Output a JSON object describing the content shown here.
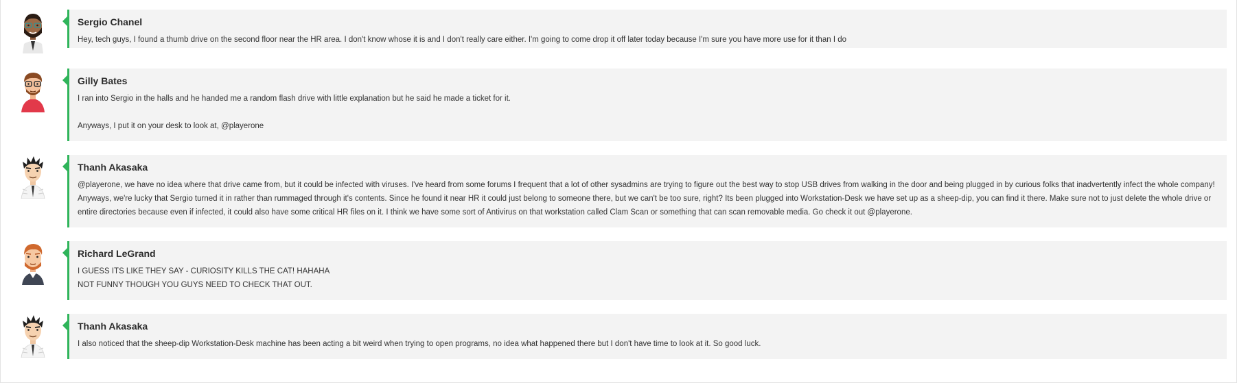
{
  "comments": [
    {
      "author": "Sergio Chanel",
      "avatar_icon": "avatar-bearded-man-icon",
      "paragraphs": [
        "Hey, tech guys, I found a thumb drive on the second floor near the HR area. I don't know whose it is and I don't really care either. I'm going to come drop it off later today because I'm sure you have more use for it than I do"
      ]
    },
    {
      "author": "Gilly Bates",
      "avatar_icon": "avatar-glasses-man-icon",
      "paragraphs": [
        "I ran into Sergio in the halls and he handed me a random flash drive with little explanation but he said he made a ticket for it.",
        "Anyways, I put it on your desk to look at, @playerone"
      ]
    },
    {
      "author": "Thanh Akasaka",
      "avatar_icon": "avatar-spiky-hair-man-icon",
      "paragraphs": [
        "@playerone, we have no idea where that drive came from, but it could be infected with viruses. I've heard from some forums I frequent that a lot of other sysadmins are trying to figure out the best way to stop USB drives from walking in the door and being plugged in by curious folks that inadvertently infect the whole company! Anyways, we're lucky that Sergio turned it in rather than rummaged through it's contents. Since he found it near HR it could just belong to someone there, but we can't be too sure, right? Its been plugged into Workstation-Desk we have set up as a sheep-dip, you can find it there. Make sure not to just delete the whole drive or entire directories because even if infected, it could also have some critical HR files on it. I think we have some sort of Antivirus on that workstation called Clam Scan or something that can scan removable media. Go check it out @playerone."
      ]
    },
    {
      "author": "Richard LeGrand",
      "avatar_icon": "avatar-redhead-man-icon",
      "paragraphs": [
        "I GUESS ITS LIKE THEY SAY - CURIOSITY KILLS THE CAT! HAHAHA",
        "NOT FUNNY THOUGH YOU GUYS NEED TO CHECK THAT OUT."
      ]
    },
    {
      "author": "Thanh Akasaka",
      "avatar_icon": "avatar-spiky-hair-man-icon",
      "paragraphs": [
        "I also noticed that the sheep-dip Workstation-Desk machine has been acting a bit weird when trying to open programs, no idea what happened there but I don't have time to look at it. So good luck."
      ]
    }
  ],
  "colors": {
    "accent": "#2fb45a",
    "bubble_bg": "#f3f3f3"
  }
}
